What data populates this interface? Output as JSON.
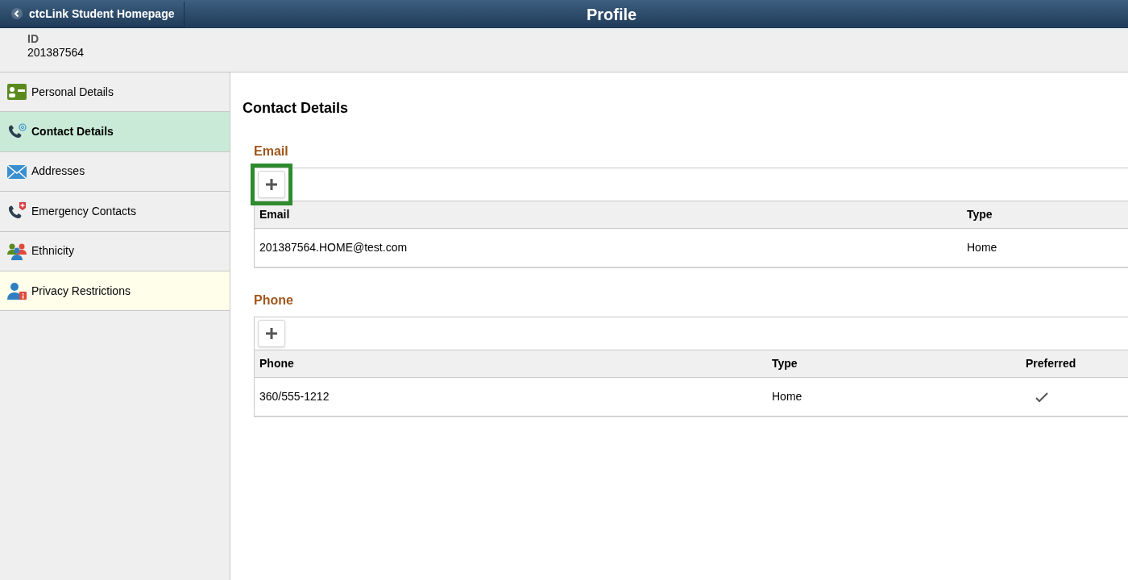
{
  "header": {
    "back_label": "ctcLink Student Homepage",
    "title": "Profile"
  },
  "id_block": {
    "label": "ID",
    "value": "201387564"
  },
  "sidebar": {
    "items": [
      {
        "label": "Personal Details",
        "kind": "person-card",
        "selected": false,
        "highlighted": false
      },
      {
        "label": "Contact Details",
        "kind": "phone-at",
        "selected": true,
        "highlighted": false
      },
      {
        "label": "Addresses",
        "kind": "envelope",
        "selected": false,
        "highlighted": false
      },
      {
        "label": "Emergency Contacts",
        "kind": "phone-cross",
        "selected": false,
        "highlighted": false
      },
      {
        "label": "Ethnicity",
        "kind": "people",
        "selected": false,
        "highlighted": false
      },
      {
        "label": "Privacy Restrictions",
        "kind": "person-info",
        "selected": false,
        "highlighted": true
      }
    ]
  },
  "content": {
    "heading": "Contact Details",
    "sections": [
      {
        "title": "Email",
        "add_highlighted": true,
        "columns": [
          {
            "label": "Email",
            "kind": "text"
          },
          {
            "label": "Type",
            "kind": "text"
          }
        ],
        "rows": [
          [
            "201387564.HOME@test.com",
            "Home"
          ]
        ]
      },
      {
        "title": "Phone",
        "add_highlighted": false,
        "columns": [
          {
            "label": "Phone",
            "kind": "text"
          },
          {
            "label": "Type",
            "kind": "text"
          },
          {
            "label": "Preferred",
            "kind": "check"
          }
        ],
        "rows": [
          [
            "360/555-1212",
            "Home",
            true
          ]
        ]
      }
    ]
  }
}
